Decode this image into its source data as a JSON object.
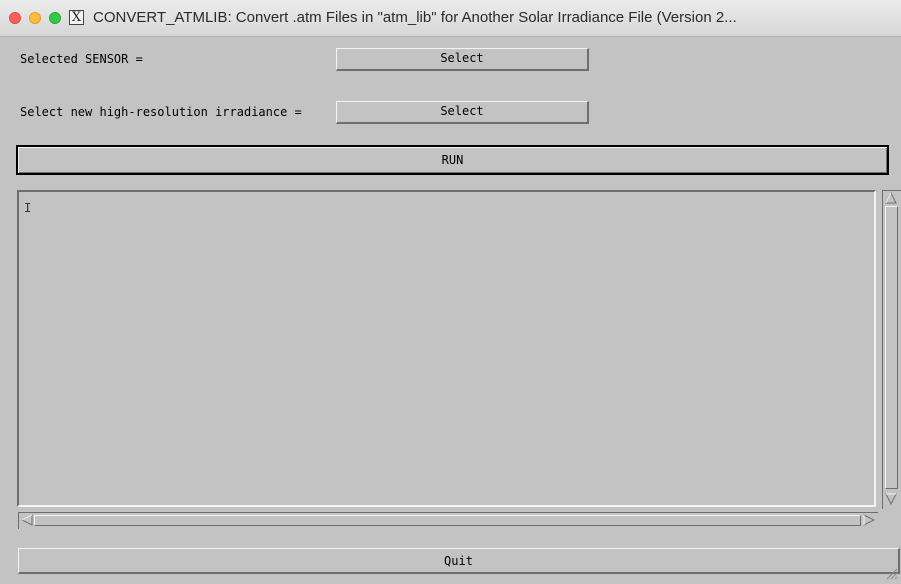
{
  "window": {
    "title": "CONVERT_ATMLIB: Convert .atm Files in \"atm_lib\" for Another Solar Irradiance File  (Version 2...",
    "x11_logo": "X"
  },
  "form": {
    "sensor_label": "Selected SENSOR =",
    "sensor_button": "Select",
    "irradiance_label": "Select new high-resolution irradiance =",
    "irradiance_button": "Select",
    "run_button": "RUN",
    "quit_button": "Quit"
  },
  "output": {
    "cursor": "I"
  },
  "colors": {
    "background": "#c3c3c3",
    "close": "#fc605c",
    "minimize": "#fdbc40",
    "maximize": "#34c84a"
  },
  "icons": [
    "close-icon",
    "minimize-icon",
    "maximize-icon",
    "x11-icon",
    "scroll-up-icon",
    "scroll-down-icon",
    "scroll-left-icon",
    "scroll-right-icon",
    "resize-grip-icon"
  ]
}
